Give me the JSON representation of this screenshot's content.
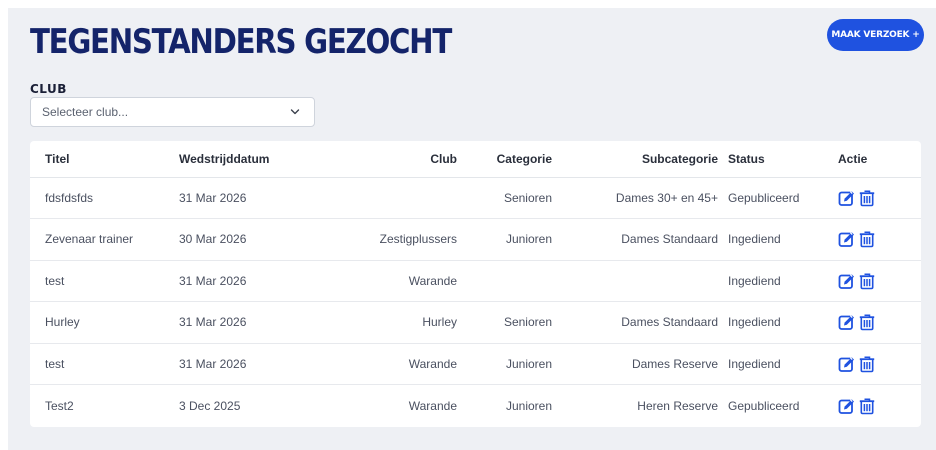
{
  "header": {
    "title": "TEGENSTANDERS GEZOCHT",
    "cta_label": "MAAK VERZOEK +"
  },
  "filter": {
    "label": "CLUB",
    "select_value": "Selecteer club..."
  },
  "table": {
    "columns": [
      "Titel",
      "Wedstrijddatum",
      "Club",
      "Categorie",
      "Subcategorie",
      "Status",
      "Actie"
    ],
    "rows": [
      {
        "titel": "fdsfdsfds",
        "datum": "31 Mar 2026",
        "club": "",
        "categorie": "Senioren",
        "subcategorie": "Dames 30+ en 45+",
        "status": "Gepubliceerd"
      },
      {
        "titel": "Zevenaar trainer",
        "datum": "30 Mar 2026",
        "club": "Zestigplussers",
        "categorie": "Junioren",
        "subcategorie": "Dames Standaard",
        "status": "Ingediend"
      },
      {
        "titel": "test",
        "datum": "31 Mar 2026",
        "club": "Warande",
        "categorie": "",
        "subcategorie": "",
        "status": "Ingediend"
      },
      {
        "titel": "Hurley",
        "datum": "31 Mar 2026",
        "club": "Hurley",
        "categorie": "Senioren",
        "subcategorie": "Dames Standaard",
        "status": "Ingediend"
      },
      {
        "titel": "test",
        "datum": "31 Mar 2026",
        "club": "Warande",
        "categorie": "Junioren",
        "subcategorie": "Dames Reserve",
        "status": "Ingediend"
      },
      {
        "titel": "Test2",
        "datum": "3 Dec 2025",
        "club": "Warande",
        "categorie": "Junioren",
        "subcategorie": "Heren Reserve",
        "status": "Gepubliceerd"
      }
    ]
  },
  "icons": {
    "edit": "edit-icon",
    "delete": "trash-icon",
    "dropdown": "chevron-down-icon"
  },
  "colors": {
    "title": "#14246a",
    "accent": "#1f52e0",
    "background": "#eef0f4"
  }
}
